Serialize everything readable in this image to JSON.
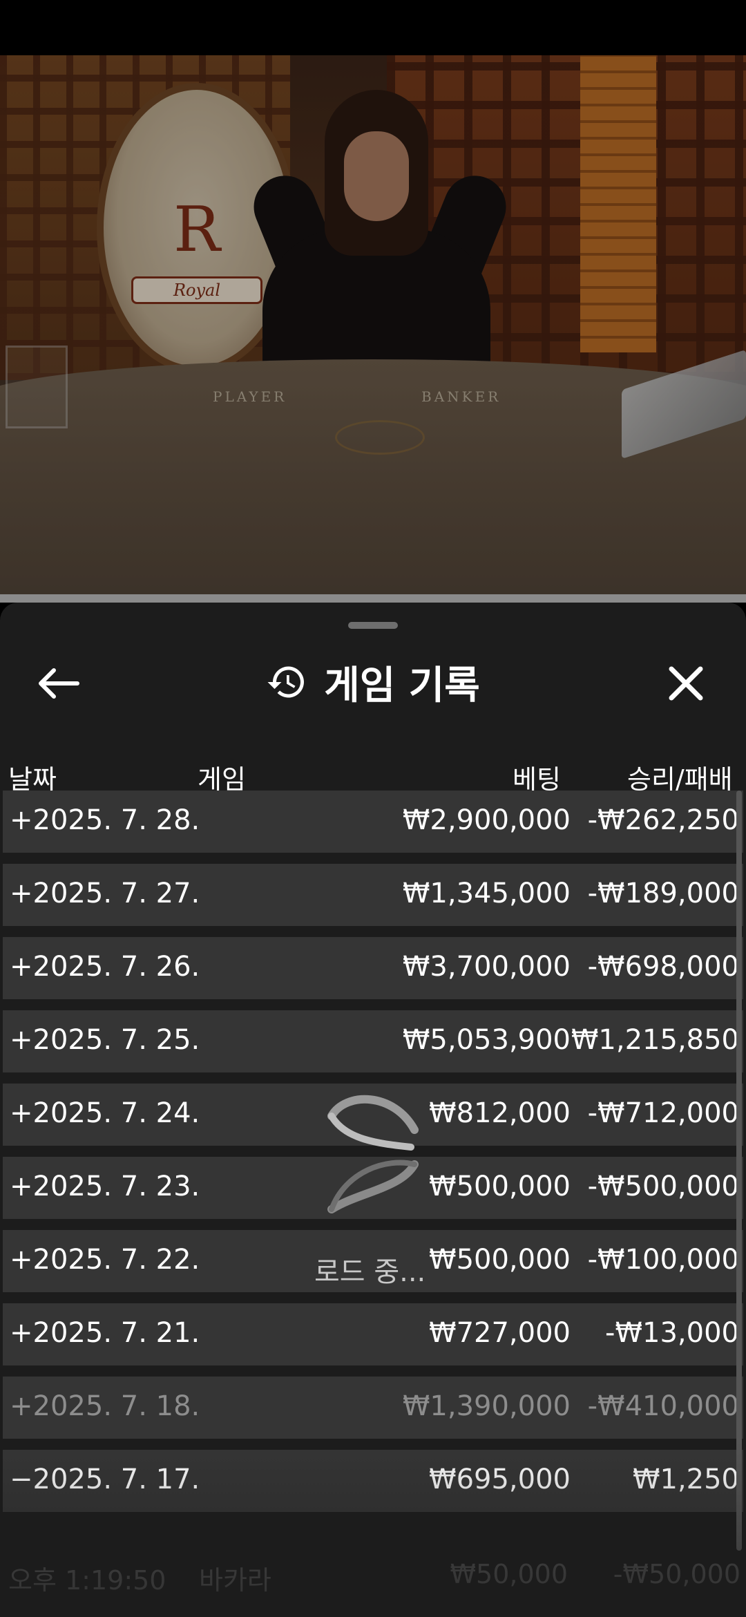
{
  "sheet": {
    "title": "게임 기록",
    "icons": {
      "back": "arrow-left-icon",
      "history": "history-icon",
      "close": "close-icon"
    }
  },
  "columns": {
    "date": "날짜",
    "game": "게임",
    "bet": "베팅",
    "result": "승리/패배"
  },
  "rows": [
    {
      "date": "+2025. 7. 28.",
      "bet": "₩2,900,000",
      "result": "-₩262,250"
    },
    {
      "date": "+2025. 7. 27.",
      "bet": "₩1,345,000",
      "result": "-₩189,000"
    },
    {
      "date": "+2025. 7. 26.",
      "bet": "₩3,700,000",
      "result": "-₩698,000"
    },
    {
      "date": "+2025. 7. 25.",
      "bet": "₩5,053,900",
      "result": "₩1,215,850"
    },
    {
      "date": "+2025. 7. 24.",
      "bet": "₩812,000",
      "result": "-₩712,000"
    },
    {
      "date": "+2025. 7. 23.",
      "bet": "₩500,000",
      "result": "-₩500,000"
    },
    {
      "date": "+2025. 7. 22.",
      "bet": "₩500,000",
      "result": "-₩100,000"
    },
    {
      "date": "+2025. 7. 21.",
      "bet": "₩727,000",
      "result": "-₩13,000"
    },
    {
      "date": "+2025. 7. 18.",
      "bet": "₩1,390,000",
      "result": "-₩410,000"
    },
    {
      "date": "−2025. 7. 17.",
      "bet": "₩695,000",
      "result": "₩1,250"
    }
  ],
  "detail": {
    "time": "오후 1:19:50",
    "game": "바카라",
    "bet": "₩50,000",
    "result": "-₩50,000"
  },
  "loading": {
    "text": "로드 중..."
  },
  "video": {
    "emblem_letter": "R",
    "emblem_ribbon": "Royal",
    "table_left": "PLAYER",
    "table_right": "BANKER"
  }
}
